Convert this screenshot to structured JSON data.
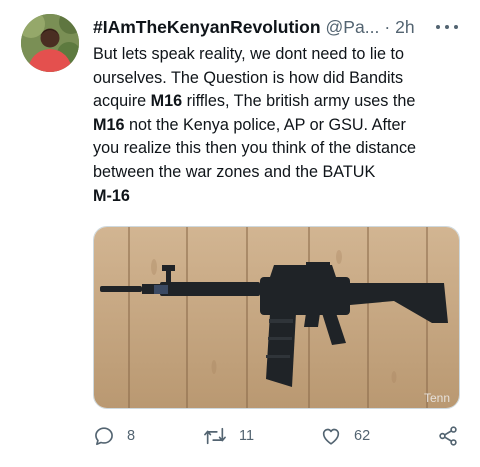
{
  "tweet": {
    "author": {
      "display_name": "#IAmTheKenyanRevolution",
      "handle": "@Pa...",
      "separator": "·",
      "time": "2h"
    },
    "text_lines": [
      [
        {
          "t": "But lets speak reality, we dont need to lie to",
          "b": false
        }
      ],
      [
        {
          "t": "ourselves. The Question is how did Bandits",
          "b": false
        }
      ],
      [
        {
          "t": "acquire ",
          "b": false
        },
        {
          "t": "M16",
          "b": true
        },
        {
          "t": " riffles, The british army uses the",
          "b": false
        }
      ],
      [
        {
          "t": "M16",
          "b": true
        },
        {
          "t": " not the Kenya police, AP or GSU. After",
          "b": false
        }
      ],
      [
        {
          "t": "you realize this then you think of the distance",
          "b": false
        }
      ],
      [
        {
          "t": "between the war zones and the BATUK",
          "b": false
        }
      ],
      [
        {
          "t": "M-16",
          "b": true
        }
      ]
    ],
    "media": {
      "watermark": "Tenn",
      "alt": "rifle on wooden planks"
    },
    "actions": {
      "reply_count": "8",
      "retweet_count": "11",
      "like_count": "62"
    }
  },
  "icons": {
    "avatar": "profile-photo",
    "more": "more-horizontal-icon",
    "reply": "reply-icon",
    "retweet": "retweet-icon",
    "like": "heart-icon",
    "share": "share-icon"
  },
  "colors": {
    "text": "#0f1419",
    "secondary": "#536471",
    "border": "#cfd9de",
    "wood": "#c9a883"
  }
}
